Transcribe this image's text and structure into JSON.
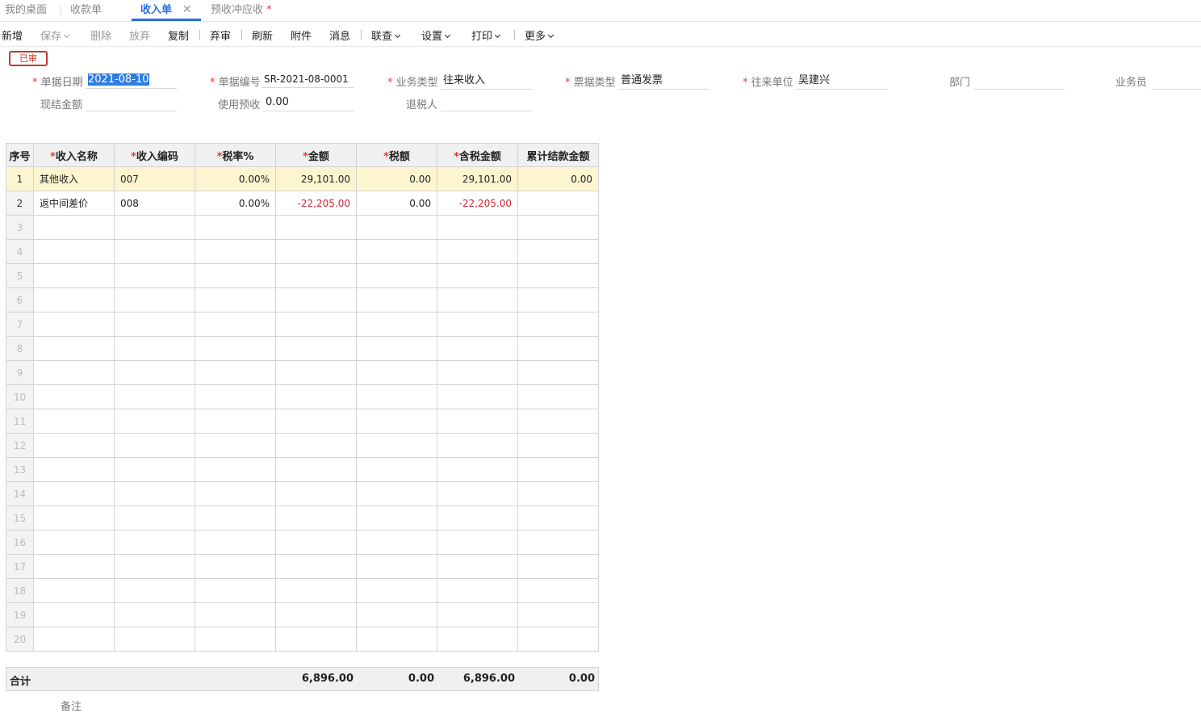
{
  "tabs": [
    {
      "label": "我的桌面",
      "active": false
    },
    {
      "label": "收款单",
      "active": false
    },
    {
      "label": "收入单",
      "active": true
    },
    {
      "label": "预收冲应收",
      "active": false,
      "modified_mark": "*"
    }
  ],
  "tab_close_glyph": "✕",
  "toolbar": {
    "new": "新增",
    "save": "保存",
    "delete": "删除",
    "discard": "放弃",
    "copy": "复制",
    "unaudit": "弃审",
    "refresh": "刷新",
    "attachment": "附件",
    "message": "消息",
    "linked_query": "联查",
    "settings": "设置",
    "print": "打印",
    "more": "更多"
  },
  "status_badge": "已审",
  "form": {
    "doc_date": {
      "label": "单据日期",
      "value": "2021-08-10",
      "required": true
    },
    "doc_no": {
      "label": "单据编号",
      "value": "SR-2021-08-0001",
      "required": true
    },
    "biz_type": {
      "label": "业务类型",
      "value": "往来收入",
      "required": true
    },
    "invoice_type": {
      "label": "票据类型",
      "value": "普通发票",
      "required": true
    },
    "partner": {
      "label": "往来单位",
      "value": "吴建兴",
      "required": true
    },
    "department": {
      "label": "部门",
      "value": "",
      "required": false
    },
    "salesman": {
      "label": "业务员",
      "value": "",
      "required": false
    },
    "cash_settle": {
      "label": "现结金额",
      "value": "",
      "required": false
    },
    "use_prepay": {
      "label": "使用预收",
      "value": "0.00",
      "required": false
    },
    "tax_refunder": {
      "label": "退税人",
      "value": "",
      "required": false
    }
  },
  "grid": {
    "headers": [
      {
        "label": "序号",
        "required": false
      },
      {
        "label": "收入名称",
        "required": true
      },
      {
        "label": "收入编码",
        "required": true
      },
      {
        "label": "税率%",
        "required": true
      },
      {
        "label": "金额",
        "required": true
      },
      {
        "label": "税额",
        "required": true
      },
      {
        "label": "含税金额",
        "required": true
      },
      {
        "label": "累计结款金额",
        "required": false
      }
    ],
    "rows": [
      {
        "idx": "1",
        "name": "其他收入",
        "code": "007",
        "tax_rate": "0.00%",
        "amount": "29,101.00",
        "tax": "0.00",
        "amount_with_tax": "29,101.00",
        "settled": "0.00",
        "selected": true
      },
      {
        "idx": "2",
        "name": "返中间差价",
        "code": "008",
        "tax_rate": "0.00%",
        "amount": "-22,205.00",
        "tax": "0.00",
        "amount_with_tax": "-22,205.00",
        "settled": "",
        "selected": false
      }
    ],
    "empty_row_indices": [
      "3",
      "4",
      "5",
      "6",
      "7",
      "8",
      "9",
      "10",
      "11",
      "12",
      "13",
      "14",
      "15",
      "16",
      "17",
      "18",
      "19",
      "20"
    ]
  },
  "total": {
    "label": "合计",
    "amount": "6,896.00",
    "tax": "0.00",
    "amount_with_tax": "6,896.00",
    "settled": "0.00"
  },
  "remark_label": "备注",
  "required_mark": "*"
}
